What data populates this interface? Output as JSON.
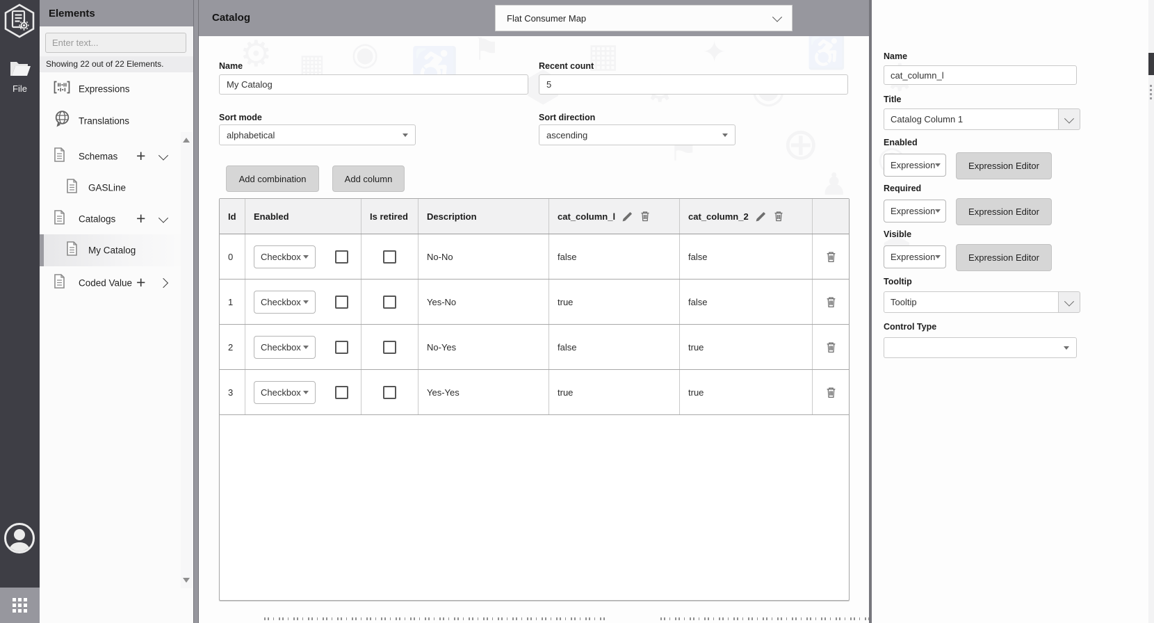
{
  "rail": {
    "file_label": "File"
  },
  "sidebar": {
    "title": "Elements",
    "search_placeholder": "Enter text...",
    "count_text": "Showing 22 out of 22 Elements.",
    "items": [
      {
        "label": "Expressions"
      },
      {
        "label": "Translations"
      },
      {
        "label": "Schemas"
      },
      {
        "label": "GASLine"
      },
      {
        "label": "Catalogs"
      },
      {
        "label": "My Catalog",
        "selected": true
      },
      {
        "label": "Coded Value"
      }
    ]
  },
  "header": {
    "title": "Catalog",
    "map_dropdown_value": "Flat Consumer Map"
  },
  "form": {
    "name_label": "Name",
    "name_value": "My Catalog",
    "recent_count_label": "Recent count",
    "recent_count_value": "5",
    "sort_mode_label": "Sort mode",
    "sort_mode_value": "alphabetical",
    "sort_direction_label": "Sort direction",
    "sort_direction_value": "ascending",
    "add_combination_label": "Add combination",
    "add_column_label": "Add column"
  },
  "table": {
    "headers": {
      "id": "Id",
      "enabled": "Enabled",
      "is_retired": "Is retired",
      "description": "Description",
      "col1": "cat_column_l",
      "col2": "cat_column_2"
    },
    "rows": [
      {
        "id": "0",
        "control": "Checkbox",
        "enabled_checked": false,
        "retired_checked": false,
        "description": "No-No",
        "col1": "false",
        "col2": "false"
      },
      {
        "id": "1",
        "control": "Checkbox",
        "enabled_checked": false,
        "retired_checked": false,
        "description": "Yes-No",
        "col1": "true",
        "col2": "false"
      },
      {
        "id": "2",
        "control": "Checkbox",
        "enabled_checked": false,
        "retired_checked": false,
        "description": "No-Yes",
        "col1": "false",
        "col2": "true"
      },
      {
        "id": "3",
        "control": "Checkbox",
        "enabled_checked": false,
        "retired_checked": false,
        "description": "Yes-Yes",
        "col1": "true",
        "col2": "true"
      }
    ]
  },
  "inspector": {
    "name_label": "Name",
    "name_value": "cat_column_l",
    "title_label": "Title",
    "title_value": "Catalog Column 1",
    "enabled_label": "Enabled",
    "required_label": "Required",
    "visible_label": "Visible",
    "expression_value": "Expression",
    "expression_editor_label": "Expression Editor",
    "tooltip_label": "Tooltip",
    "tooltip_value": "Tooltip",
    "control_type_label": "Control Type",
    "control_type_value": ""
  },
  "icons": {
    "add": "+",
    "logo": "hexagon-document-gear",
    "file": "open-folder",
    "avatar": "user-circle",
    "apps": "grid-dots",
    "expressions": "code-bars",
    "translations": "globe-bubble",
    "element": "document-page",
    "collapse": "chevron-down",
    "expand": "chevron-right",
    "edit": "pencil",
    "delete": "trash",
    "dropdown": "triangle-down"
  },
  "colors": {
    "header_gray": "#97979e",
    "rail_dark": "#3e3e45",
    "button_gray": "#d6d6d6",
    "divider_dark": "#77777d"
  }
}
